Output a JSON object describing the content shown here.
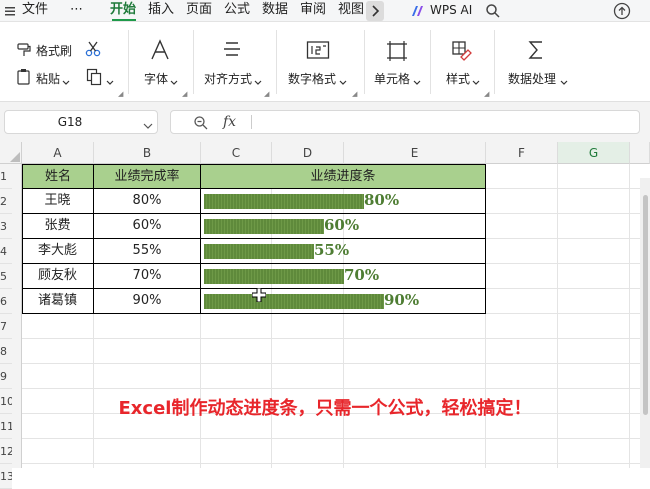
{
  "menu": {
    "file": "文件",
    "more": "⋯",
    "tabs": [
      "开始",
      "插入",
      "页面",
      "公式",
      "数据",
      "审阅",
      "视图"
    ],
    "scroll_right": "›",
    "wps_ai": "WPS AI"
  },
  "ribbon": {
    "format_painter": "格式刷",
    "paste": "粘贴",
    "font": "字体",
    "align": "对齐方式",
    "number_format": "数字格式",
    "cell": "单元格",
    "style": "样式",
    "data_processing": "数据处理"
  },
  "formula_bar": {
    "cell_ref": "G18",
    "fx": "fx",
    "value": ""
  },
  "columns": [
    "A",
    "B",
    "C",
    "D",
    "E",
    "F",
    "G"
  ],
  "rows": [
    "1",
    "2",
    "3",
    "4",
    "5",
    "6",
    "7",
    "8",
    "9",
    "10",
    "11",
    "12",
    "13"
  ],
  "table": {
    "headers": [
      "姓名",
      "业绩完成率",
      "业绩进度条"
    ],
    "records": [
      {
        "name": "王晓",
        "rate": "80%",
        "bar_text": "80%",
        "progress": 0.8
      },
      {
        "name": "张费",
        "rate": "60%",
        "bar_text": "60%",
        "progress": 0.6
      },
      {
        "name": "李大彪",
        "rate": "55%",
        "bar_text": "55%",
        "progress": 0.55
      },
      {
        "name": "顾友秋",
        "rate": "70%",
        "bar_text": "70%",
        "progress": 0.7
      },
      {
        "name": "诸葛镇",
        "rate": "90%",
        "bar_text": "90%",
        "progress": 0.9
      }
    ]
  },
  "caption": "Excel制作动态进度条，只需一个公式，轻松搞定！",
  "colors": {
    "header_fill": "#a9d08e",
    "bar": "#5f8a3b",
    "bar_text": "#4e7d33",
    "caption": "#e8262b",
    "active_tab": "#1f7a3a"
  }
}
